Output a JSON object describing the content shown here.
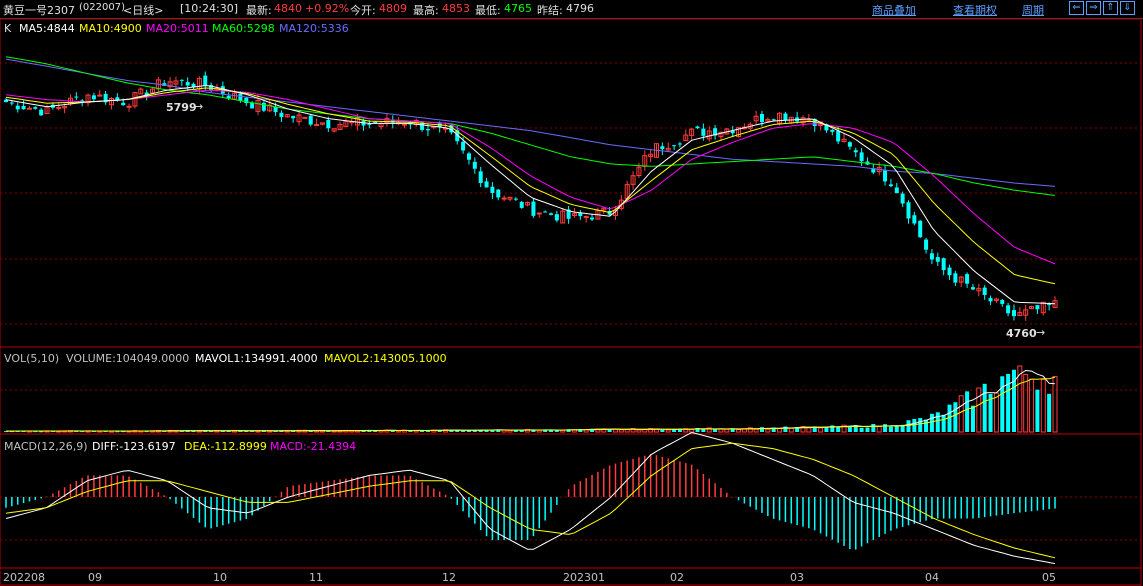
{
  "header": {
    "symbol": "黄豆一号2307",
    "code": "(022007)",
    "period": "<日线>",
    "time": "[10:24:30]",
    "latest_label": "最新:",
    "latest": "4840",
    "change": "+0.92%",
    "open_label": "今开:",
    "open": "4809",
    "high_label": "最高:",
    "high": "4853",
    "low_label": "最低:",
    "low": "4765",
    "prev_label": "昨结:",
    "prev": "4796",
    "links": [
      "商品叠加",
      "查看期权",
      "周期"
    ]
  },
  "colors": {
    "up": "#ff3c3c",
    "down": "#00ffff",
    "ma5": "#ffffff",
    "ma10": "#ffff00",
    "ma20": "#ff00ff",
    "ma60": "#00ff00",
    "ma120": "#6a6aff",
    "grid": "#880000",
    "axis": "#bb0000"
  },
  "price_panel": {
    "k_label": "K",
    "ma_labels": [
      {
        "key": "ma5",
        "text": "MA5:4844"
      },
      {
        "key": "ma10",
        "text": "MA10:4900"
      },
      {
        "key": "ma20",
        "text": "MA20:5011"
      },
      {
        "key": "ma60",
        "text": "MA60:5298"
      },
      {
        "key": "ma120",
        "text": "MA120:5336"
      }
    ],
    "high_mark": "5799",
    "low_mark": "4760"
  },
  "vol_panel": {
    "label": "VOL(5,10)",
    "volume": "VOLUME:104049.0000",
    "mavol1": "MAVOL1:134991.4000",
    "mavol2": "MAVOL2:143005.1000"
  },
  "macd_panel": {
    "label": "MACD(12,26,9)",
    "diff": "DIFF:-123.6197",
    "dea": "DEA:-112.8999",
    "macd": "MACD:-21.4394"
  },
  "x_axis": [
    "202208",
    "09",
    "10",
    "11",
    "12",
    "202301",
    "02",
    "03",
    "04",
    "05"
  ],
  "chart_data": {
    "type": "candlestick",
    "title": "黄豆一号2307",
    "x": [
      "202208",
      "09",
      "10",
      "11",
      "12",
      "202301",
      "02",
      "03",
      "04",
      "05"
    ],
    "series": [
      {
        "name": "close",
        "values": [
          5690,
          5650,
          5720,
          5690,
          5780,
          5760,
          5690,
          5630,
          5600,
          5600,
          5610,
          5550,
          5320,
          5240,
          5200,
          5230,
          5490,
          5560,
          5580,
          5640,
          5620,
          5480,
          5350,
          5010,
          4900,
          4790,
          4840
        ]
      },
      {
        "name": "MA5",
        "values": [
          5700,
          5670,
          5690,
          5700,
          5740,
          5760,
          5720,
          5660,
          5620,
          5600,
          5600,
          5580,
          5430,
          5290,
          5230,
          5210,
          5400,
          5530,
          5570,
          5610,
          5620,
          5540,
          5420,
          5150,
          4980,
          4850,
          4844
        ]
      },
      {
        "name": "MA20",
        "values": [
          5720,
          5700,
          5690,
          5700,
          5720,
          5740,
          5730,
          5700,
          5660,
          5620,
          5610,
          5600,
          5500,
          5380,
          5290,
          5240,
          5320,
          5450,
          5520,
          5580,
          5600,
          5580,
          5520,
          5380,
          5220,
          5080,
          5011
        ]
      },
      {
        "name": "MA60",
        "values": [
          5880,
          5850,
          5810,
          5770,
          5740,
          5720,
          5690,
          5660,
          5640,
          5620,
          5610,
          5600,
          5560,
          5510,
          5460,
          5430,
          5420,
          5430,
          5440,
          5450,
          5460,
          5440,
          5420,
          5390,
          5350,
          5320,
          5298
        ]
      },
      {
        "name": "MA120",
        "values": [
          5870,
          5840,
          5810,
          5780,
          5760,
          5730,
          5710,
          5690,
          5670,
          5650,
          5630,
          5610,
          5590,
          5570,
          5540,
          5510,
          5490,
          5470,
          5450,
          5440,
          5430,
          5420,
          5400,
          5390,
          5370,
          5350,
          5336
        ]
      },
      {
        "name": "VOLUME",
        "values": [
          2000,
          2000,
          2200,
          2100,
          2300,
          2500,
          2400,
          2600,
          2800,
          3000,
          3200,
          3500,
          3800,
          4000,
          4500,
          5000,
          5500,
          6000,
          7000,
          8000,
          9000,
          11000,
          14000,
          30000,
          70000,
          120000,
          104049
        ]
      },
      {
        "name": "DIFF",
        "values": [
          -40,
          -20,
          30,
          50,
          30,
          -20,
          -30,
          0,
          20,
          40,
          50,
          30,
          -60,
          -100,
          -60,
          0,
          80,
          120,
          100,
          70,
          40,
          -10,
          -30,
          -60,
          -90,
          -110,
          -123.6197
        ]
      },
      {
        "name": "DEA",
        "values": [
          -30,
          -20,
          10,
          30,
          30,
          10,
          -10,
          -10,
          5,
          20,
          30,
          30,
          -20,
          -60,
          -70,
          -30,
          40,
          90,
          100,
          90,
          70,
          40,
          0,
          -40,
          -70,
          -95,
          -112.8999
        ]
      }
    ],
    "annotations": [
      "5799",
      "4760"
    ],
    "legend": "top-left"
  }
}
